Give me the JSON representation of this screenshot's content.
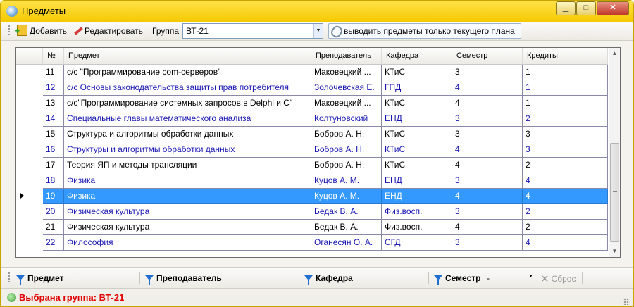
{
  "window": {
    "title": "Предметы",
    "minimize": "▁",
    "maximize": "□",
    "close": "✕"
  },
  "toolbar": {
    "add_label": "Добавить",
    "edit_label": "Редактировать",
    "group_label": "Группа",
    "group_value": "ВТ-21",
    "toggle_label": "выводить предметы только текущего  плана"
  },
  "grid": {
    "columns": [
      "№",
      "Предмет",
      "Преподаватель",
      "Кафедра",
      "Семестр",
      "Кредиты"
    ],
    "rows": [
      {
        "n": "11",
        "subject": "с/с \"Программирование com-серверов\"",
        "teacher": "Маковецкий ...",
        "dept": "КТиС",
        "sem": "3",
        "cred": "1"
      },
      {
        "n": "12",
        "subject": "с/с Основы законодательства защиты прав потребителя",
        "teacher": "Золочевская Е.",
        "dept": "ГПД",
        "sem": "4",
        "cred": "1"
      },
      {
        "n": "13",
        "subject": "с/с\"Программирование системных запросов в Delphi и С\"",
        "teacher": "Маковецкий ...",
        "dept": "КТиС",
        "sem": "4",
        "cred": "1"
      },
      {
        "n": "14",
        "subject": "Специальные главы математического анализа",
        "teacher": "Колтуновский",
        "dept": "ЕНД",
        "sem": "3",
        "cred": "2"
      },
      {
        "n": "15",
        "subject": "Структура и алгоритмы обработки данных",
        "teacher": "Бобров А. Н.",
        "dept": "КТиС",
        "sem": "3",
        "cred": "3"
      },
      {
        "n": "16",
        "subject": "Структуры и алгоритмы обработки данных",
        "teacher": "Бобров А. Н.",
        "dept": "КТиС",
        "sem": "4",
        "cred": "3"
      },
      {
        "n": "17",
        "subject": "Теория ЯП и методы трансляции",
        "teacher": "Бобров А. Н.",
        "dept": "КТиС",
        "sem": "4",
        "cred": "2"
      },
      {
        "n": "18",
        "subject": "Физика",
        "teacher": "Куцов А. М.",
        "dept": "ЕНД",
        "sem": "3",
        "cred": "4"
      },
      {
        "n": "19",
        "subject": "Физика",
        "teacher": "Куцов А. М.",
        "dept": "ЕНД",
        "sem": "4",
        "cred": "4"
      },
      {
        "n": "20",
        "subject": "Физическая культура",
        "teacher": "Бедак В. А.",
        "dept": "Физ.восп.",
        "sem": "3",
        "cred": "2"
      },
      {
        "n": "21",
        "subject": "Физическая культура",
        "teacher": "Бедак В. А.",
        "dept": "Физ.восп.",
        "sem": "4",
        "cred": "2"
      },
      {
        "n": "22",
        "subject": "Философия",
        "teacher": "Оганесян О. А.",
        "dept": "СГД",
        "sem": "3",
        "cred": "4"
      }
    ],
    "selected_row": "19"
  },
  "filters": {
    "subject": "Предмет",
    "teacher": "Преподаватель",
    "dept": "Кафедра",
    "semester": "Семестр",
    "semester_value": "-",
    "reset": "Сброс"
  },
  "status": {
    "text": "Выбрана группа: ВТ-21"
  },
  "colors": {
    "titlebar": "#f5c900",
    "selected_row": "#3399ff",
    "alt_text": "#1a18b0",
    "status_text": "#e00000"
  }
}
